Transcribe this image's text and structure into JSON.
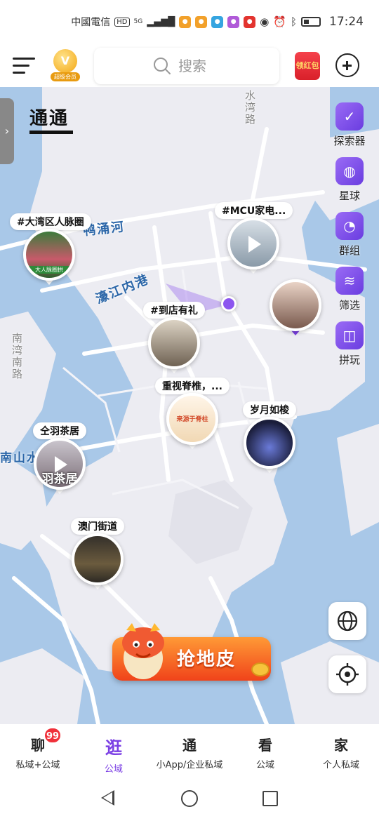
{
  "status_bar": {
    "carrier": "中國電信",
    "hd": "HD",
    "network": "5G",
    "time": "17:24"
  },
  "top_bar": {
    "vip_badge_text": "超级会员",
    "search_placeholder": "搜索",
    "red_envelope_text": "领红包"
  },
  "map": {
    "title": "通通",
    "road_labels": [
      "鸭涌河",
      "濠江内港",
      "水湾路",
      "南湾南路",
      "南山水"
    ],
    "right_menu": [
      {
        "label": "探索器",
        "icon": "explorer-icon"
      },
      {
        "label": "星球",
        "icon": "planet-icon"
      },
      {
        "label": "群组",
        "icon": "group-chat-icon"
      },
      {
        "label": "筛选",
        "icon": "filter-icon"
      },
      {
        "label": "拼玩",
        "icon": "gamepad-icon"
      }
    ],
    "pois": [
      {
        "label": "#大湾区人脉圈",
        "caption": "大人脉圈拱"
      },
      {
        "label": "#MCU家电..."
      },
      {
        "label": ""
      },
      {
        "label": "#到店有礼"
      },
      {
        "label": "重视脊椎，...",
        "caption": "来源于脊柱"
      },
      {
        "label": "岁月如梭"
      },
      {
        "label": "仝羽茶居",
        "caption": "羽茶居"
      },
      {
        "label": "澳门街道"
      }
    ],
    "grab_land_label": "抢地皮"
  },
  "bottom_nav": {
    "items": [
      {
        "title": "聊",
        "sub": "私域+公域",
        "badge": "99"
      },
      {
        "title": "逛",
        "sub": "公域"
      },
      {
        "title": "通",
        "sub": "小App/企业私域"
      },
      {
        "title": "看",
        "sub": "公域"
      },
      {
        "title": "家",
        "sub": "个人私域"
      }
    ],
    "active_index": 1
  },
  "colors": {
    "accent": "#7b3fe4",
    "water": "#a9c8e8",
    "land": "#ececf2",
    "badge_red": "#f0303a",
    "grab_orange": "#f0431a"
  }
}
